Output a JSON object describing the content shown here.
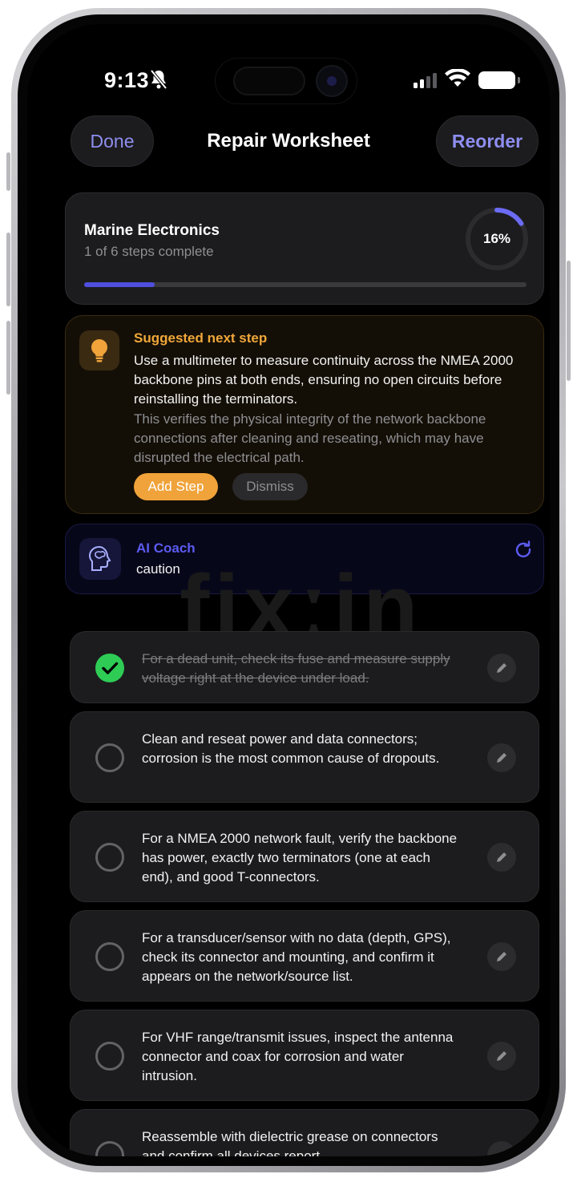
{
  "status_bar": {
    "time": "9:13"
  },
  "nav": {
    "done_label": "Done",
    "title": "Repair Worksheet",
    "reorder_label": "Reorder"
  },
  "progress": {
    "title": "Marine Electronics",
    "subtitle": "1 of 6 steps complete",
    "percent_label": "16%",
    "fraction": 0.16,
    "ring_color": "#6b6bf5",
    "bar_color": "#4f4fe0"
  },
  "suggestion": {
    "title": "Suggested next step",
    "body": "Use a multimeter to measure continuity across the NMEA 2000 backbone pins at both ends, ensuring no open circuits before reinstalling the terminators.",
    "reason": "This verifies the physical integrity of the network backbone connections after cleaning and reseating, which may have disrupted the electrical path.",
    "add_label": "Add Step",
    "dismiss_label": "Dismiss",
    "icon": "lightbulb-icon"
  },
  "coach": {
    "title": "AI Coach",
    "text": "caution",
    "icon": "brain-head-icon"
  },
  "watermark": "fixːin",
  "steps": [
    {
      "text": "For a dead unit, check its fuse and measure supply voltage right at the device under load.",
      "done": true
    },
    {
      "text": "Clean and reseat power and data connectors; corrosion is the most common cause of dropouts.",
      "done": false
    },
    {
      "text": "For a NMEA 2000 network fault, verify the backbone has power, exactly two terminators (one at each end), and good T-connectors.",
      "done": false
    },
    {
      "text": "For a transducer/sensor with no data (depth, GPS), check its connector and mounting, and confirm it appears on the network/source list.",
      "done": false
    },
    {
      "text": "For VHF range/transmit issues, inspect the antenna connector and coax for corrosion and water intrusion.",
      "done": false
    },
    {
      "text": "Reassemble with dielectric grease on connectors and confirm all devices report",
      "done": false
    }
  ],
  "colors": {
    "accent": "#8e8ef0",
    "orange": "#f0a33a",
    "green": "#2ecc55"
  }
}
